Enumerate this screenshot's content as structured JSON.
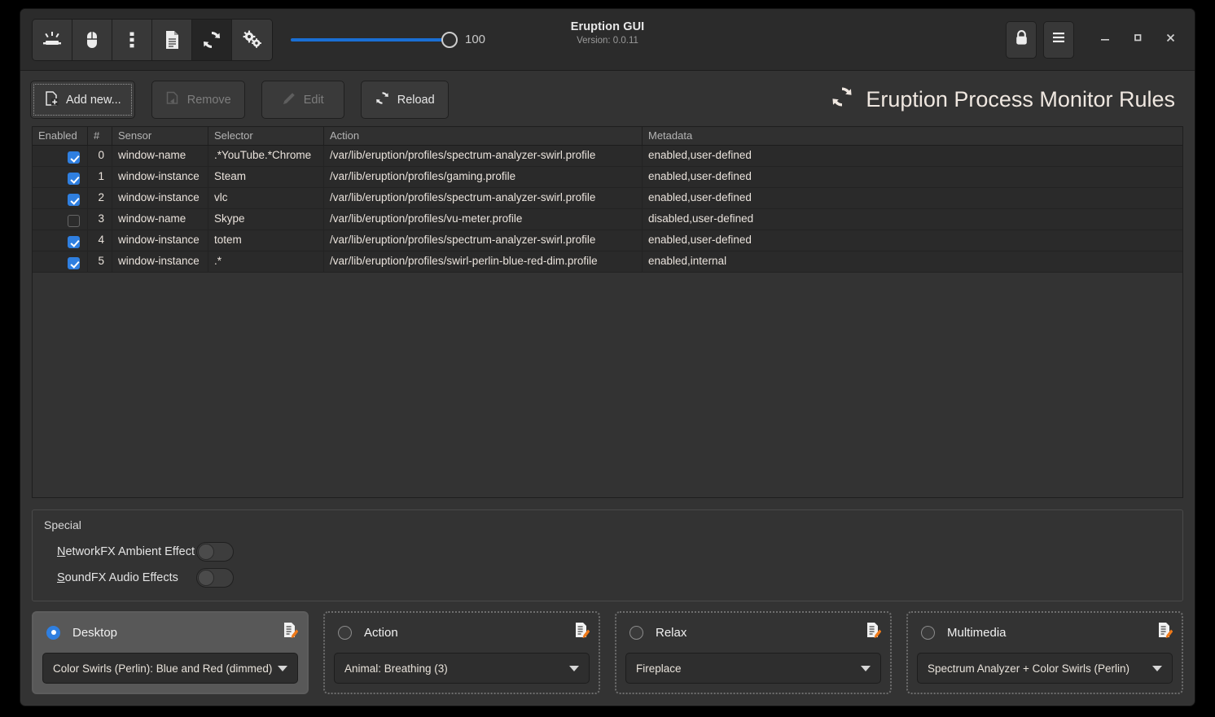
{
  "window": {
    "title": "Eruption GUI",
    "version": "Version: 0.0.11",
    "accent_blue": "#2f7fe0",
    "heading_color": "#efe7e0",
    "background": "#333333"
  },
  "toolbar": {
    "icons": [
      {
        "name": "keyboard-led-icon",
        "label": "Keyboards",
        "active": false
      },
      {
        "name": "mouse-icon",
        "label": "Mice",
        "active": false
      },
      {
        "name": "misc-devices-icon",
        "label": "Misc Devices",
        "active": false
      },
      {
        "name": "profiles-document-icon",
        "label": "Profiles",
        "active": false
      },
      {
        "name": "process-monitor-icon",
        "label": "Process Monitor",
        "active": true
      },
      {
        "name": "settings-gears-icon",
        "label": "Settings",
        "active": false
      }
    ],
    "brightness_value": "100",
    "brightness_percent": 100
  },
  "header_controls": {
    "lock_label": "lock-icon",
    "menu_label": "hamburger-menu-icon",
    "minimize_label": "–",
    "maximize_label": "▫",
    "close_label": "✕"
  },
  "actions": {
    "add_new": "Add new...",
    "remove": "Remove",
    "edit": "Edit",
    "reload": "Reload"
  },
  "page": {
    "heading": "Eruption Process Monitor Rules"
  },
  "table": {
    "columns": [
      "Enabled",
      "#",
      "Sensor",
      "Selector",
      "Action",
      "Metadata"
    ],
    "rows": [
      {
        "enabled": true,
        "num": "0",
        "sensor": "window-name",
        "selector": ".*YouTube.*Chrome",
        "action": "/var/lib/eruption/profiles/spectrum-analyzer-swirl.profile",
        "metadata": "enabled,user-defined"
      },
      {
        "enabled": true,
        "num": "1",
        "sensor": "window-instance",
        "selector": "Steam",
        "action": "/var/lib/eruption/profiles/gaming.profile",
        "metadata": "enabled,user-defined"
      },
      {
        "enabled": true,
        "num": "2",
        "sensor": "window-instance",
        "selector": "vlc",
        "action": "/var/lib/eruption/profiles/spectrum-analyzer-swirl.profile",
        "metadata": "enabled,user-defined"
      },
      {
        "enabled": false,
        "num": "3",
        "sensor": "window-name",
        "selector": "Skype",
        "action": "/var/lib/eruption/profiles/vu-meter.profile",
        "metadata": "disabled,user-defined"
      },
      {
        "enabled": true,
        "num": "4",
        "sensor": "window-instance",
        "selector": "totem",
        "action": "/var/lib/eruption/profiles/spectrum-analyzer-swirl.profile",
        "metadata": "enabled,user-defined"
      },
      {
        "enabled": true,
        "num": "5",
        "sensor": "window-instance",
        "selector": ".*",
        "action": "/var/lib/eruption/profiles/swirl-perlin-blue-red-dim.profile",
        "metadata": "enabled,internal"
      }
    ]
  },
  "special": {
    "title": "Special",
    "networkfx": {
      "label_mnemonic": "N",
      "label_rest": "etworkFX Ambient Effect",
      "on": false
    },
    "soundfx": {
      "label_mnemonic": "S",
      "label_rest": "oundFX Audio Effects",
      "on": false
    }
  },
  "slots": [
    {
      "name": "Desktop",
      "profile": "Color Swirls (Perlin): Blue and Red (dimmed)",
      "selected": true
    },
    {
      "name": "Action",
      "profile": "Animal: Breathing (3)",
      "selected": false
    },
    {
      "name": "Relax",
      "profile": "Fireplace",
      "selected": false
    },
    {
      "name": "Multimedia",
      "profile": "Spectrum Analyzer + Color Swirls (Perlin)",
      "selected": false
    }
  ]
}
